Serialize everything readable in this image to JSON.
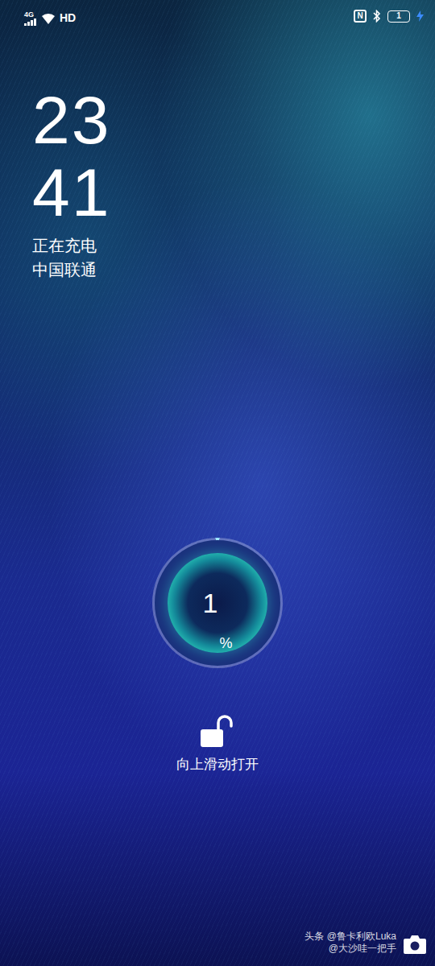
{
  "status_bar": {
    "network": "4G",
    "hd": "HD",
    "nfc": "N",
    "battery": {
      "text": "1",
      "level": 0.01,
      "charging": true
    }
  },
  "clock": {
    "hours": "23",
    "minutes": "41"
  },
  "charging_status": "正在充电",
  "carrier": "中国联通",
  "charge_meter": {
    "number": "1",
    "unit": "%",
    "level": 0.01
  },
  "unlock": {
    "label": "向上滑动打开"
  },
  "watermark": [
    "头条 @鲁卡利欧Luka",
    "@大沙哇一把手"
  ]
}
